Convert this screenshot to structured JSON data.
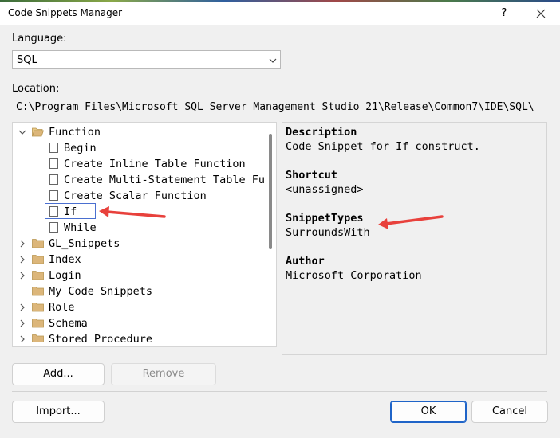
{
  "window": {
    "title": "Code Snippets Manager",
    "help_label": "?",
    "close_icon": "close-icon"
  },
  "language": {
    "label": "Language:",
    "value": "SQL"
  },
  "location": {
    "label": "Location:",
    "path": "C:\\Program Files\\Microsoft SQL Server Management Studio 21\\Release\\Common7\\IDE\\SQL\\"
  },
  "tree": {
    "items": [
      {
        "label": "Function",
        "type": "folder",
        "expanded": true,
        "level": 0
      },
      {
        "label": "Begin",
        "type": "snippet",
        "level": 1
      },
      {
        "label": "Create Inline Table Function",
        "type": "snippet",
        "level": 1
      },
      {
        "label": "Create Multi-Statement Table Function",
        "type": "snippet",
        "level": 1
      },
      {
        "label": "Create Scalar Function",
        "type": "snippet",
        "level": 1
      },
      {
        "label": "If",
        "type": "snippet",
        "level": 1,
        "selected": true
      },
      {
        "label": "While",
        "type": "snippet",
        "level": 1
      },
      {
        "label": "GL_Snippets",
        "type": "folder",
        "expanded": false,
        "level": 0
      },
      {
        "label": "Index",
        "type": "folder",
        "expanded": false,
        "level": 0
      },
      {
        "label": "Login",
        "type": "folder",
        "expanded": false,
        "level": 0
      },
      {
        "label": "My Code Snippets",
        "type": "folder",
        "expanded": false,
        "level": 0,
        "no_caret": true
      },
      {
        "label": "Role",
        "type": "folder",
        "expanded": false,
        "level": 0
      },
      {
        "label": "Schema",
        "type": "folder",
        "expanded": false,
        "level": 0
      },
      {
        "label": "Stored Procedure",
        "type": "folder",
        "expanded": false,
        "level": 0
      }
    ]
  },
  "details": {
    "description_heading": "Description",
    "description": "Code Snippet for If construct.",
    "shortcut_heading": "Shortcut",
    "shortcut": "<unassigned>",
    "snippettypes_heading": "SnippetTypes",
    "snippettypes": "SurroundsWith",
    "author_heading": "Author",
    "author": "Microsoft Corporation"
  },
  "buttons": {
    "add": "Add...",
    "remove": "Remove",
    "import": "Import...",
    "ok": "OK",
    "cancel": "Cancel"
  },
  "colors": {
    "annotation_arrow": "#e8413c",
    "folder": "#dcb67a",
    "selection_border": "#4a6fd0",
    "default_button": "#1f64c8"
  }
}
